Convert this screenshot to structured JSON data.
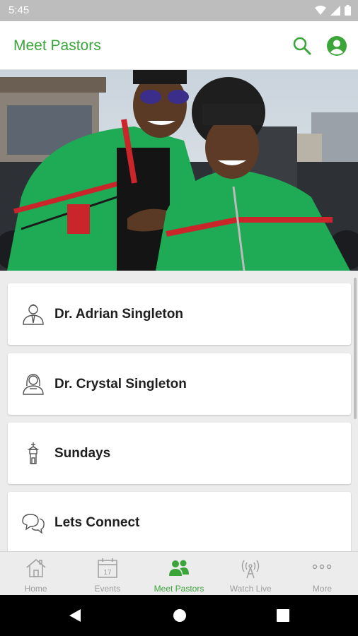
{
  "status_bar": {
    "time": "5:45"
  },
  "app_bar": {
    "title": "Meet Pastors"
  },
  "list": {
    "items": [
      {
        "label": "Dr. Adrian Singleton",
        "icon": "pastor-male-icon"
      },
      {
        "label": "Dr. Crystal Singleton",
        "icon": "pastor-female-icon"
      },
      {
        "label": "Sundays",
        "icon": "church-steeple-icon"
      },
      {
        "label": "Lets Connect",
        "icon": "chat-bubbles-icon"
      }
    ]
  },
  "bottom_nav": {
    "items": [
      {
        "label": "Home",
        "icon": "home-icon"
      },
      {
        "label": "Events",
        "icon": "calendar-icon",
        "day": "17"
      },
      {
        "label": "Meet Pastors",
        "icon": "people-icon",
        "active": true
      },
      {
        "label": "Watch Live",
        "icon": "broadcast-tower-icon"
      },
      {
        "label": "More",
        "icon": "more-dots-icon"
      }
    ]
  },
  "colors": {
    "accent": "#3ca53a",
    "background": "#ececec",
    "status_bar": "#bdbdbd"
  }
}
